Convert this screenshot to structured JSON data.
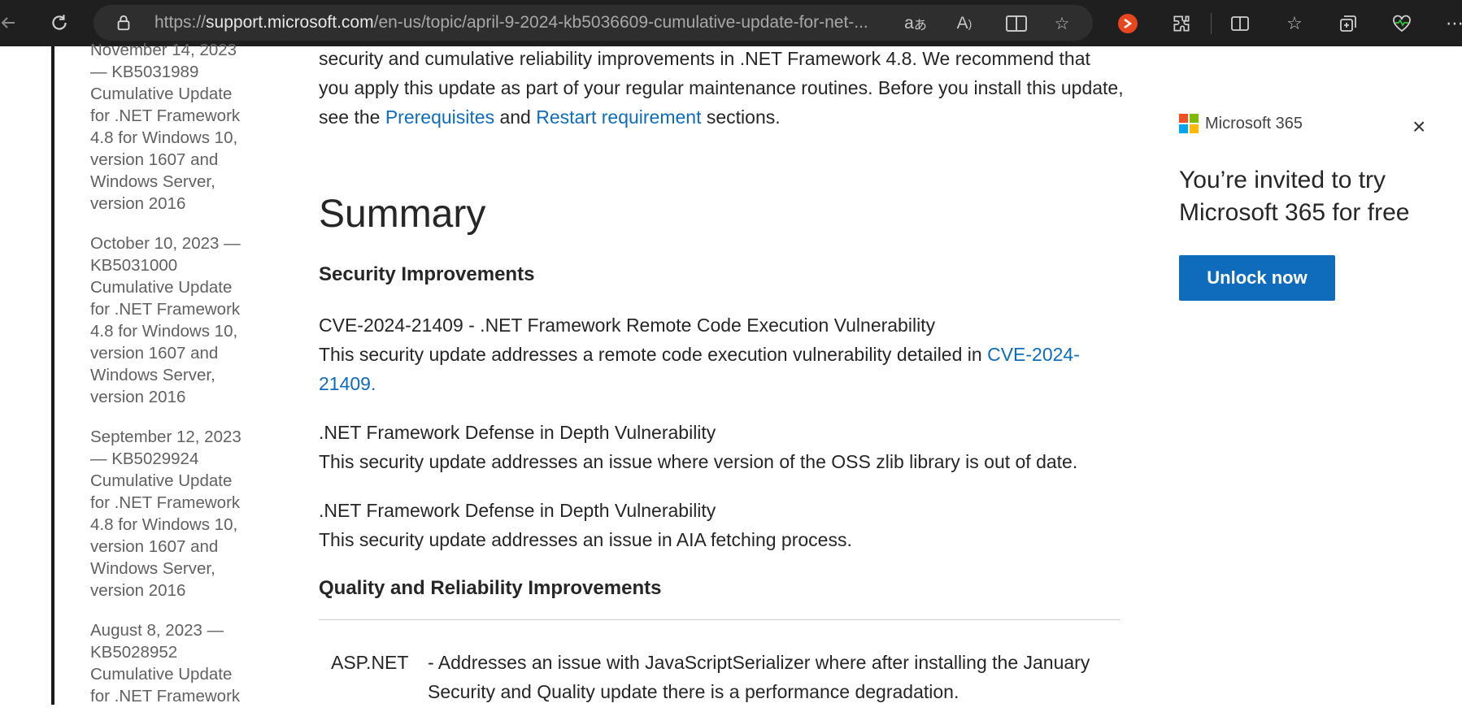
{
  "browser": {
    "url_prefix": "https://",
    "url_host": "support.microsoft.com",
    "url_path": "/en-us/topic/april-9-2024-kb5036609-cumulative-update-for-net-..."
  },
  "sidebar": {
    "links": [
      "November 14, 2023 — KB5031989 Cumulative Update for .NET Framework 4.8 for Windows 10, version 1607 and Windows Server, version 2016",
      "October 10, 2023 — KB5031000 Cumulative Update for .NET Framework 4.8 for Windows 10, version 1607 and Windows Server, version 2016",
      "September 12, 2023 — KB5029924 Cumulative Update for .NET Framework 4.8 for Windows 10, version 1607 and Windows Server, version 2016",
      "August 8, 2023 — KB5028952 Cumulative Update for .NET Framework"
    ]
  },
  "article": {
    "intro_text_1": "security and cumulative reliability improvements in .NET Framework 4.8. We recommend that you apply this update as part of your regular maintenance routines. Before you install this update, see the ",
    "intro_link_1": "Prerequisites",
    "intro_text_2": " and ",
    "intro_link_2": "Restart requirement",
    "intro_text_3": " sections.",
    "summary_heading": "Summary",
    "security_heading": "Security Improvements",
    "cve_title": "CVE-2024-21409 - .NET Framework Remote Code Execution Vulnerability",
    "cve_text": "This security update addresses a remote code execution vulnerability detailed in ",
    "cve_link": "CVE-2024-21409.",
    "defense1_title": ".NET Framework Defense in Depth Vulnerability",
    "defense1_text": "This security update addresses an issue where version of the OSS zlib library is out of date.",
    "defense2_title": ".NET Framework Defense in Depth Vulnerability",
    "defense2_text": "This security update addresses an issue in AIA fetching process.",
    "quality_heading": "Quality and Reliability Improvements",
    "table_label": "ASP.NET",
    "table_desc": "- Addresses an issue with JavaScriptSerializer where after installing the January Security and Quality update there is a performance degradation."
  },
  "promo": {
    "brand": "Microsoft 365",
    "close_glyph": "×",
    "title": "You’re invited to try Microsoft 365 for free",
    "button": "Unlock now"
  },
  "colors": {
    "link": "#0f6cbd",
    "toolbar_bg": "#1f1f1f",
    "ms_red": "#f25022",
    "ms_green": "#7fba00",
    "ms_blue": "#00a4ef",
    "ms_yellow": "#ffb900"
  }
}
